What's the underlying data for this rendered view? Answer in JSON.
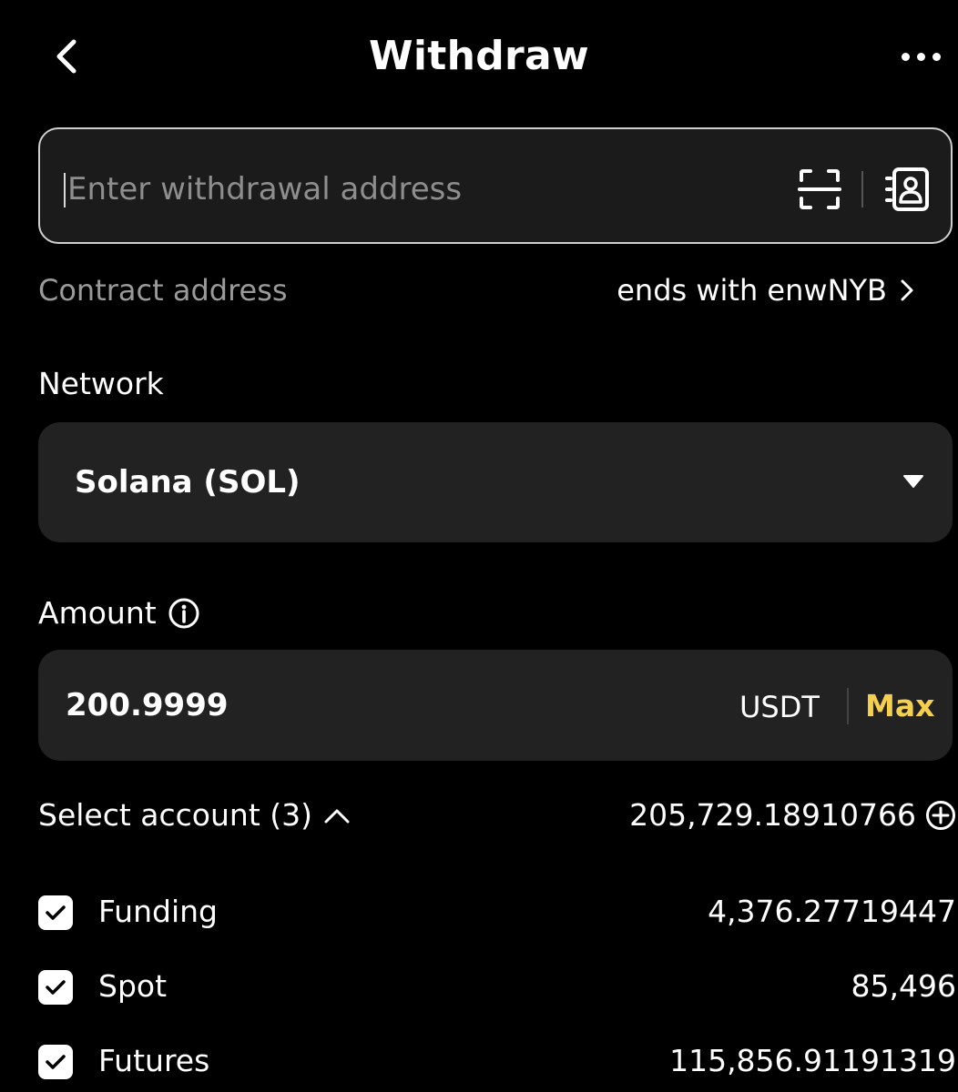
{
  "header": {
    "title": "Withdraw"
  },
  "address": {
    "placeholder": "Enter withdrawal address",
    "value": ""
  },
  "contract": {
    "label": "Contract address",
    "value": "ends with enwNYB"
  },
  "network": {
    "label": "Network",
    "selected": "Solana (SOL)"
  },
  "amount": {
    "label": "Amount",
    "value": "200.9999",
    "currency": "USDT",
    "max_label": "Max"
  },
  "accounts": {
    "header_label": "Select account (3)",
    "total": "205,729.18910766",
    "items": [
      {
        "name": "Funding",
        "value": "4,376.27719447",
        "checked": true
      },
      {
        "name": "Spot",
        "value": "85,496",
        "checked": true
      },
      {
        "name": "Futures",
        "value": "115,856.91191319",
        "checked": true
      }
    ]
  },
  "colors": {
    "background": "#000000",
    "field": "#222222",
    "accent": "#f5d04f",
    "muted": "#9a9a9a"
  }
}
